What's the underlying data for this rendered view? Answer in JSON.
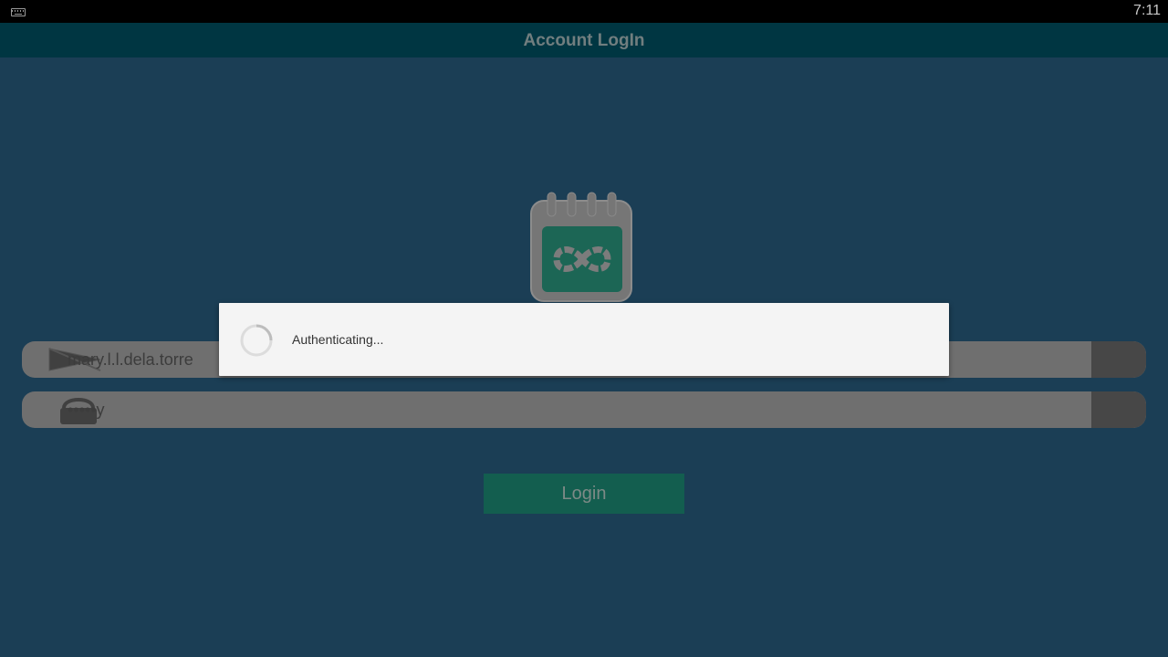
{
  "status_bar": {
    "time": "7:11",
    "keyboard_icon": "keyboard-icon"
  },
  "app_bar": {
    "title": "Account LogIn"
  },
  "logo": {
    "icon": "calendar-infinity-icon"
  },
  "form": {
    "username": {
      "value": "mary.l.l.dela.torre",
      "icon": "user-icon"
    },
    "password": {
      "value": "•••••y",
      "icon": "lock-icon"
    },
    "login_label": "Login"
  },
  "dialog": {
    "message": "Authenticating...",
    "spinner_icon": "spinner-icon"
  },
  "colors": {
    "background": "#1b3e55",
    "app_bar": "#003642",
    "login_button": "#135e4f",
    "dialog": "#f4f4f4"
  }
}
